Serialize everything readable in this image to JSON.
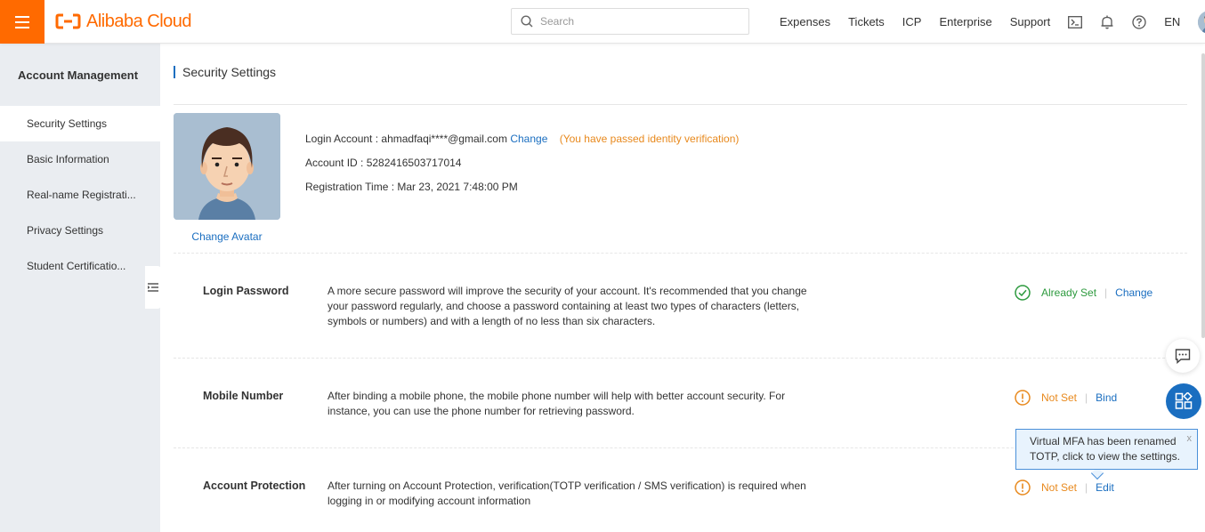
{
  "header": {
    "brand": "Alibaba Cloud",
    "search_placeholder": "Search",
    "nav": [
      "Expenses",
      "Tickets",
      "ICP",
      "Enterprise",
      "Support"
    ],
    "lang": "EN",
    "icons": [
      "terminal-icon",
      "bell-icon",
      "help-icon"
    ]
  },
  "sidebar": {
    "title": "Account Management",
    "items": [
      {
        "label": "Security Settings",
        "active": true
      },
      {
        "label": "Basic Information",
        "active": false
      },
      {
        "label": "Real-name Registrati...",
        "active": false
      },
      {
        "label": "Privacy Settings",
        "active": false
      },
      {
        "label": "Student Certificatio...",
        "active": false
      }
    ]
  },
  "main": {
    "title": "Security Settings",
    "change_avatar": "Change Avatar",
    "login_account_label": "Login Account : ahmadfaqi****@gmail.com",
    "login_account_change": "Change",
    "verification_note": "(You have passed identity verification)",
    "account_id": "Account ID : 5282416503717014",
    "registration_time": "Registration Time : Mar 23, 2021 7:48:00 PM",
    "settings": [
      {
        "label": "Login Password",
        "description": "A more secure password will improve the security of your account. It's recommended that you change your password regularly, and choose a password containing at least two types of characters (letters, symbols or numbers) and with a length of no less than six characters.",
        "status": "Already Set",
        "action": "Change"
      },
      {
        "label": "Mobile Number",
        "description": "After binding a mobile phone, the mobile phone number will help with better account security. For instance, you can use the phone number for retrieving password.",
        "status": "Not Set",
        "action": "Bind"
      },
      {
        "label": "Account Protection",
        "description": "After turning on Account Protection, verification(TOTP verification / SMS verification) is required when logging in or modifying account information",
        "status": "Not Set",
        "action": "Edit"
      }
    ]
  },
  "tooltip": {
    "text": "Virtual MFA has been renamed TOTP, click to view the settings.",
    "close": "x"
  },
  "colors": {
    "brand": "#ff6a00",
    "link": "#1a6ec0",
    "success": "#2d9a3e",
    "warning": "#e8891d"
  }
}
